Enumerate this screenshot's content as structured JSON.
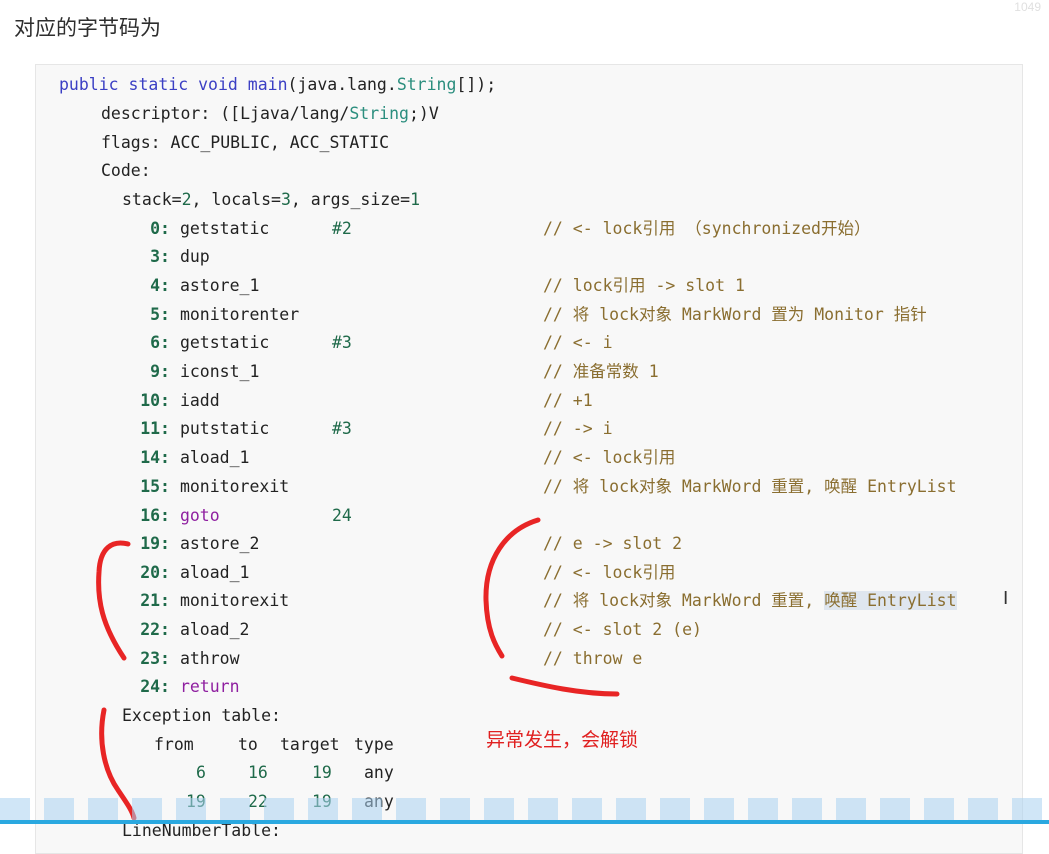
{
  "title": "对应的字节码为",
  "watermark": "1049",
  "method_signature": {
    "kw1": "public",
    "kw2": "static",
    "kw3": "void",
    "name": "main",
    "pre_type": "(java.lang.",
    "type": "String",
    "post_type": "[]);"
  },
  "descriptor": {
    "label": "descriptor: ([Ljava/lang/",
    "type": "String",
    "tail": ";)V"
  },
  "flags_line": "flags: ACC_PUBLIC, ACC_STATIC",
  "code_label": "Code:",
  "stack_line": {
    "a": "stack=",
    "b": "2",
    "c": ", locals=",
    "d": "3",
    "e": ", args_size=",
    "f": "1"
  },
  "instructions": [
    {
      "idx": "0:",
      "op": "getstatic",
      "arg": "#2",
      "comment": "// <- lock引用 （synchronized开始）"
    },
    {
      "idx": "3:",
      "op": "dup",
      "arg": "",
      "comment": ""
    },
    {
      "idx": "4:",
      "op": "astore_1",
      "arg": "",
      "comment": "// lock引用 -> slot 1"
    },
    {
      "idx": "5:",
      "op": "monitorenter",
      "arg": "",
      "comment": "// 将 lock对象 MarkWord 置为 Monitor 指针"
    },
    {
      "idx": "6:",
      "op": "getstatic",
      "arg": "#3",
      "comment": "// <- i"
    },
    {
      "idx": "9:",
      "op": "iconst_1",
      "arg": "",
      "comment": "// 准备常数 1"
    },
    {
      "idx": "10:",
      "op": "iadd",
      "arg": "",
      "comment": "// +1"
    },
    {
      "idx": "11:",
      "op": "putstatic",
      "arg": "#3",
      "comment": "// -> i"
    },
    {
      "idx": "14:",
      "op": "aload_1",
      "arg": "",
      "comment": "// <- lock引用"
    },
    {
      "idx": "15:",
      "op": "monitorexit",
      "arg": "",
      "comment": "// 将 lock对象 MarkWord 重置, 唤醒 EntryList"
    },
    {
      "idx": "16:",
      "op": "goto",
      "arg": "24",
      "comment": ""
    },
    {
      "idx": "19:",
      "op": "astore_2",
      "arg": "",
      "comment": "// e -> slot 2"
    },
    {
      "idx": "20:",
      "op": "aload_1",
      "arg": "",
      "comment": "// <- lock引用"
    },
    {
      "idx": "21:",
      "op": "monitorexit",
      "arg": "",
      "comment_a": "// 将 lock对象 MarkWord 重置, ",
      "comment_b": "唤醒 EntryList"
    },
    {
      "idx": "22:",
      "op": "aload_2",
      "arg": "",
      "comment": "// <- slot 2 (e)"
    },
    {
      "idx": "23:",
      "op": "athrow",
      "arg": "",
      "comment": "// throw e"
    },
    {
      "idx": "24:",
      "op": "return",
      "arg": "",
      "comment": ""
    }
  ],
  "exception_table": {
    "label": "Exception table:",
    "headers": [
      "from",
      "to",
      "target",
      "type"
    ],
    "rows": [
      [
        "6",
        "16",
        "19",
        "any"
      ],
      [
        "19",
        "22",
        "19",
        "any"
      ]
    ]
  },
  "line_number_table_label": "LineNumberTable:",
  "annotation": "异常发生，会解锁",
  "cursor_glyph": "I",
  "colors": {
    "comment": "#8a6e30",
    "keyword": "#3b3fc4",
    "number": "#1f6a4a",
    "annotation_red": "#e02020",
    "bar_blue": "#2aa8e0"
  }
}
